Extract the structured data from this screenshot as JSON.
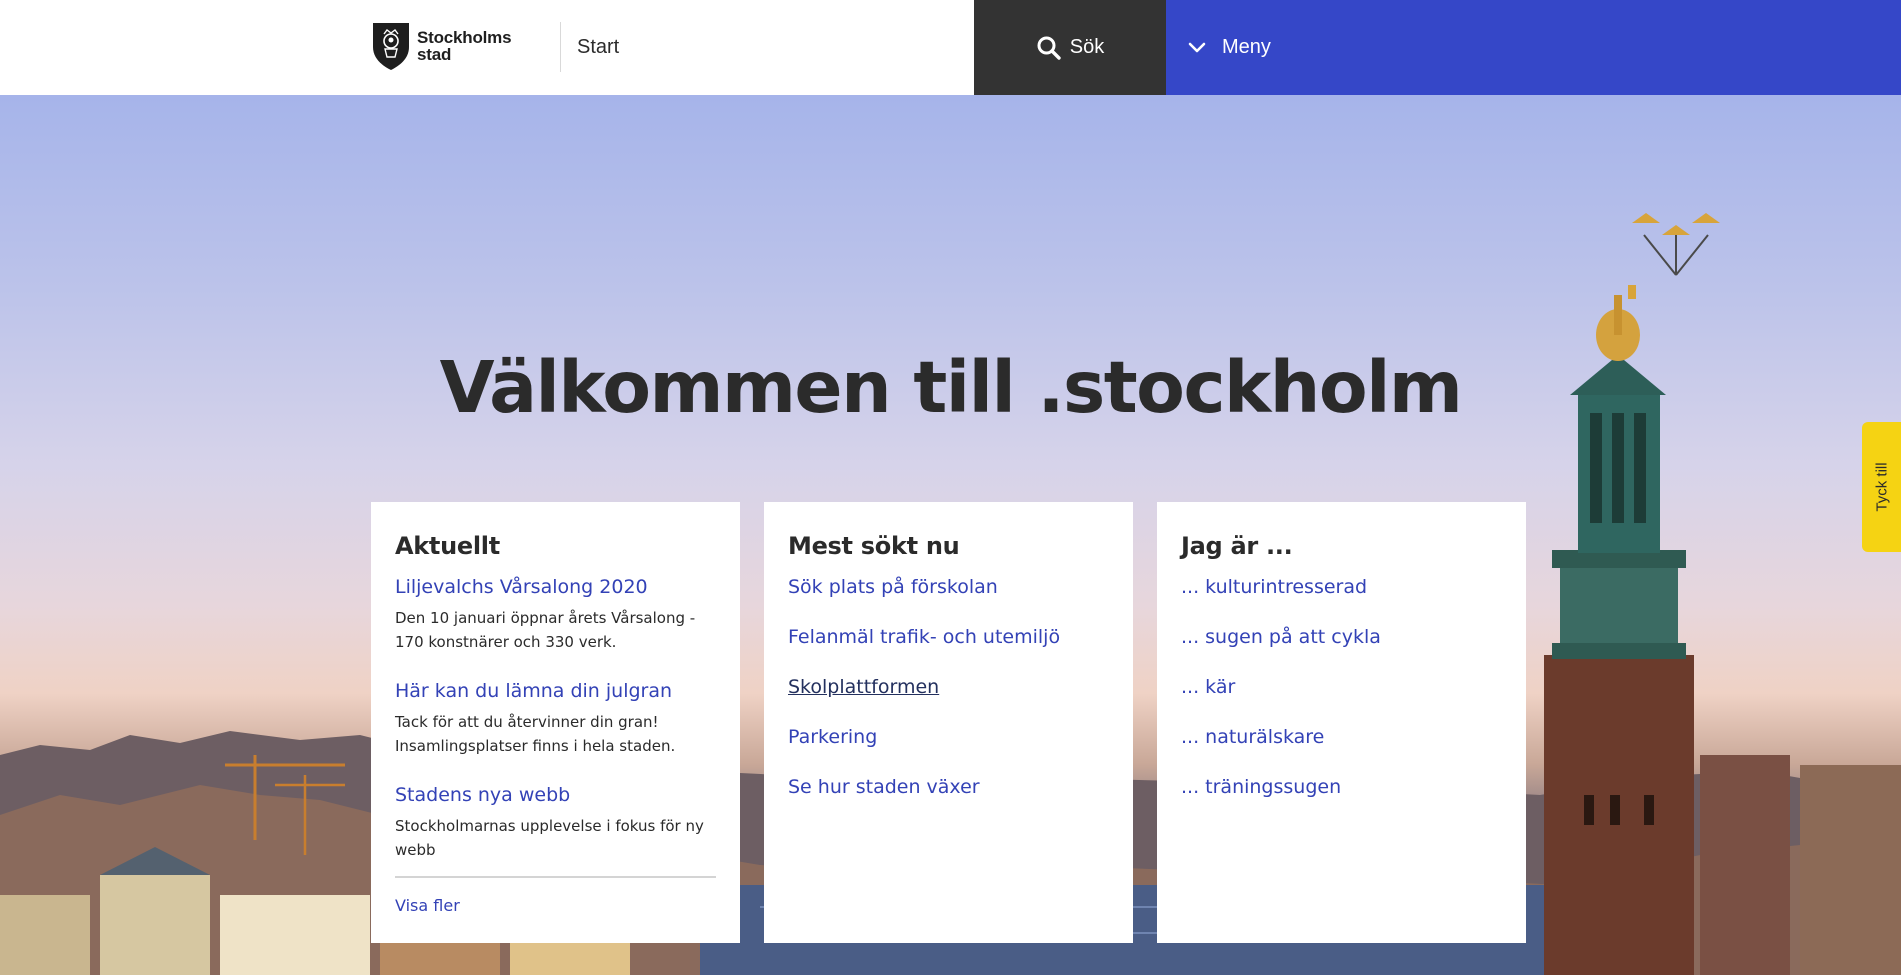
{
  "header": {
    "logo_line1": "Stockholms",
    "logo_line2": "stad",
    "breadcrumb": "Start",
    "search_label": "Sök",
    "menu_label": "Meny"
  },
  "hero": {
    "title": "Välkommen till .stockholm"
  },
  "news": {
    "title": "Aktuellt",
    "items": [
      {
        "title": "Liljevalchs Vårsalong 2020",
        "description": "Den 10 januari öppnar årets Vårsalong - 170 konstnärer och 330 verk."
      },
      {
        "title": "Här kan du lämna din julgran",
        "description": "Tack för att du återvinner din gran! Insamlingsplatser finns i hela staden."
      },
      {
        "title": "Stadens nya webb",
        "description": "Stockholmarnas upplevelse i fokus för ny webb"
      }
    ],
    "show_more": "Visa fler"
  },
  "most_searched": {
    "title": "Mest sökt nu",
    "links": [
      "Sök plats på förskolan",
      "Felanmäl trafik- och utemiljö",
      "Skolplattformen",
      "Parkering",
      "Se hur staden växer"
    ]
  },
  "i_am": {
    "title": "Jag är ...",
    "links": [
      "... kulturintresserad",
      "... sugen på att cykla",
      "... kär",
      "... naturälskare",
      "... träningssugen"
    ]
  },
  "feedback": {
    "label": "Tyck till",
    "color": "#f5d313"
  },
  "colors": {
    "menu": "#3547c8",
    "search": "#333333",
    "link": "#3342b6"
  },
  "icons": {
    "search": "search-icon",
    "menu": "chevron-down-icon",
    "logo": "coat-of-arms-icon"
  }
}
